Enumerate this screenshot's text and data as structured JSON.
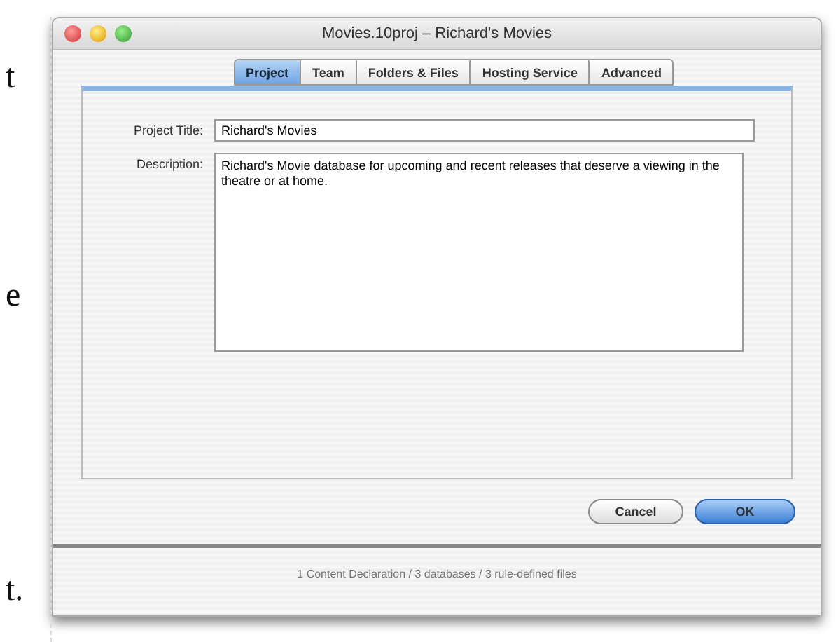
{
  "page_text": [
    "t",
    "e",
    "t."
  ],
  "window": {
    "title": "Movies.10proj – Richard's Movies"
  },
  "tabs": [
    {
      "label": "Project",
      "selected": true
    },
    {
      "label": "Team",
      "selected": false
    },
    {
      "label": "Folders & Files",
      "selected": false
    },
    {
      "label": "Hosting Service",
      "selected": false
    },
    {
      "label": "Advanced",
      "selected": false
    }
  ],
  "form": {
    "project_title_label": "Project Title:",
    "project_title": "Richard's Movies",
    "description_label": "Description:",
    "description": "Richard's Movie database for upcoming and recent releases that deserve a viewing in the theatre or at home."
  },
  "buttons": [
    {
      "label": "Cancel",
      "default": false
    },
    {
      "label": "OK",
      "default": true
    }
  ],
  "status_bar": "1 Content Declaration / 3 databases / 3 rule-defined files"
}
